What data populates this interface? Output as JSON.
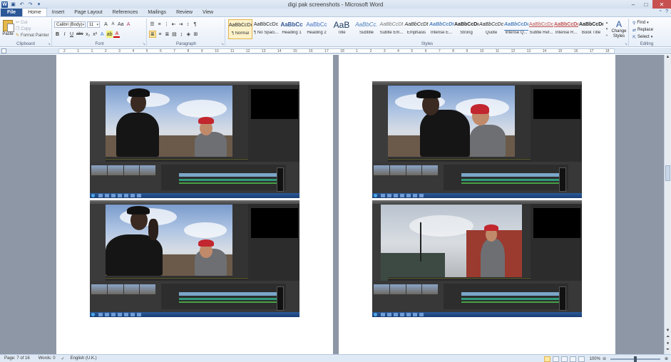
{
  "window": {
    "title": "digi pak screenshots - Microsoft Word",
    "qat_icons": [
      "word-icon",
      "save-icon",
      "undo-icon",
      "redo-icon",
      "customize-icon"
    ]
  },
  "tabs": [
    "File",
    "Home",
    "Insert",
    "Page Layout",
    "References",
    "Mailings",
    "Review",
    "View"
  ],
  "active_tab": "Home",
  "ribbon": {
    "clipboard": {
      "label": "Clipboard",
      "paste": "Paste",
      "cut": "Cut",
      "copy": "Copy",
      "format_painter": "Format Painter"
    },
    "font": {
      "label": "Font",
      "font_name": "Calibri (Body)",
      "font_size": "11",
      "grow": "A",
      "shrink": "A",
      "change_case": "Aa",
      "clear": "A",
      "bold": "B",
      "italic": "I",
      "underline": "U",
      "strike": "abc",
      "subscript": "x₂",
      "superscript": "x²",
      "effects": "A",
      "highlight": "ab",
      "color": "A"
    },
    "paragraph": {
      "label": "Paragraph"
    },
    "styles": {
      "label": "Styles",
      "items": [
        {
          "sample": "AaBbCcDc",
          "name": "¶ Normal"
        },
        {
          "sample": "AaBbCcDc",
          "name": "¶ No Spaci..."
        },
        {
          "sample": "AaBbCc",
          "name": "Heading 1"
        },
        {
          "sample": "AaBbCc",
          "name": "Heading 2"
        },
        {
          "sample": "AaB",
          "name": "Title"
        },
        {
          "sample": "AaBbCc.",
          "name": "Subtitle"
        },
        {
          "sample": "AaBbCcDt",
          "name": "Subtle Em..."
        },
        {
          "sample": "AaBbCcDt",
          "name": "Emphasis"
        },
        {
          "sample": "AaBbCcDt",
          "name": "Intense E..."
        },
        {
          "sample": "AaBbCcDc",
          "name": "Strong"
        },
        {
          "sample": "AaBbCcDc",
          "name": "Quote"
        },
        {
          "sample": "AaBbCcDc",
          "name": "Intense Q..."
        },
        {
          "sample": "AaBbCcDc",
          "name": "Subtle Ref..."
        },
        {
          "sample": "AaBbCcDc",
          "name": "Intense R..."
        },
        {
          "sample": "AaBbCcDc",
          "name": "Book Title"
        }
      ],
      "change_styles": "Change Styles"
    },
    "editing": {
      "label": "Editing",
      "find": "Find",
      "replace": "Replace",
      "select": "Select"
    }
  },
  "ruler_marks": [
    "2",
    "1",
    "1",
    "2",
    "3",
    "4",
    "5",
    "6",
    "7",
    "8",
    "9",
    "10",
    "11",
    "12",
    "13",
    "14",
    "15",
    "16",
    "17",
    "18",
    "1",
    "2",
    "3",
    "4",
    "5",
    "6",
    "7",
    "8",
    "9",
    "10",
    "11",
    "12",
    "13",
    "14",
    "15",
    "16",
    "17",
    "18"
  ],
  "status": {
    "page": "Page: 7 of 16",
    "words": "Words: 0",
    "language": "English (U.K.)",
    "zoom": "100%"
  },
  "colors": {
    "file_tab": "#2b5797",
    "doc_background": "#8d97a5",
    "accent": "#e3b24b"
  }
}
